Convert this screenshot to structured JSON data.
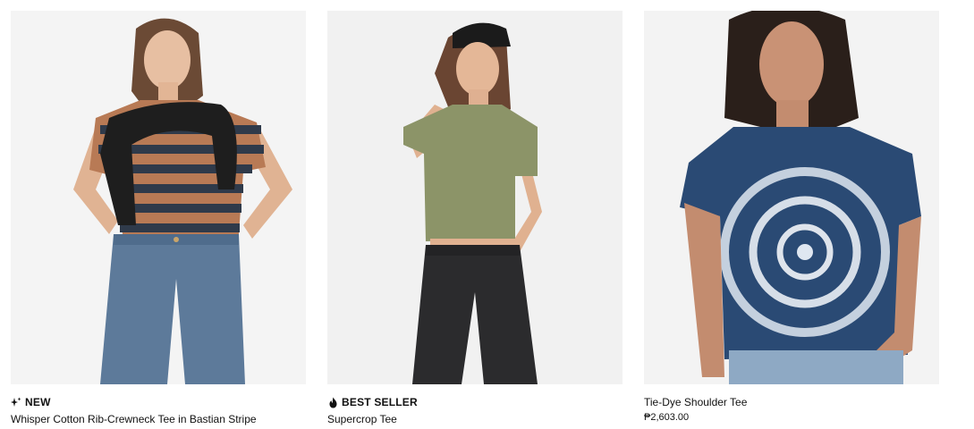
{
  "products": [
    {
      "badge": "NEW",
      "badge_icon": "sparkle-icon",
      "name": "Whisper Cotton Rib-Crewneck Tee in Bastian Stripe",
      "price": ""
    },
    {
      "badge": "BEST SELLER",
      "badge_icon": "flame-icon",
      "name": "Supercrop Tee",
      "price": ""
    },
    {
      "badge": "",
      "badge_icon": "",
      "name": "Tie-Dye Shoulder Tee",
      "price": "₱2,603.00"
    }
  ],
  "colors": {
    "text": "#111111",
    "image_bg": "#f3f3f3",
    "stripe_rust": "#b87a55",
    "stripe_navy": "#2f3a4a",
    "olive": "#8c9468",
    "denim": "#5d7a9a",
    "tie_dye_navy": "#2a4a74"
  }
}
